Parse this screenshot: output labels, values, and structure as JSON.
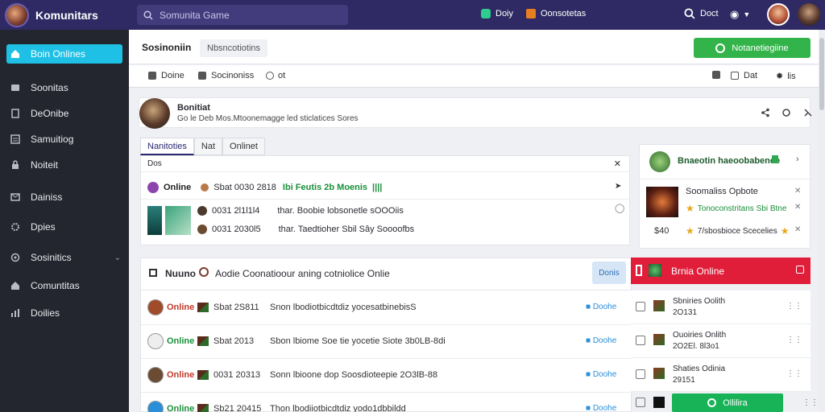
{
  "app": {
    "name": "Komunitars"
  },
  "search": {
    "placeholder": "Somunita Game"
  },
  "top": {
    "link1": "Doiy",
    "link2": "Oonsotetas",
    "link3": "Doct"
  },
  "sidebar": {
    "items": [
      {
        "label": "Boin Onlines",
        "icon": "home-icon"
      },
      {
        "label": "Soonitas",
        "icon": "tools-icon"
      },
      {
        "label": "DeOnibe",
        "icon": "document-icon"
      },
      {
        "label": "Samuitiog",
        "icon": "list-icon"
      },
      {
        "label": "Noiteit",
        "icon": "lock-icon"
      },
      {
        "label": "Dainiss",
        "icon": "mail-icon"
      },
      {
        "label": "Dpies",
        "icon": "gear-icon"
      },
      {
        "label": "Sosinitics",
        "icon": "shield-icon"
      },
      {
        "label": "Comuntitas",
        "icon": "house-icon"
      },
      {
        "label": "Doilies",
        "icon": "chart-icon"
      }
    ]
  },
  "header": {
    "title": "Sosinoniin",
    "chip": "Nbsncotiotins",
    "button": "Notanetiegiine"
  },
  "toolbar": {
    "left1": "Doine",
    "left2": "Socinoniss",
    "left3": "ot",
    "right1": "Dat",
    "right2": "lis"
  },
  "profile": {
    "name": "Bonitiat",
    "sub": "Go le Deb Mos.Mtoonemagge led sticlatices Sores"
  },
  "tabs": [
    "Nanitoties",
    "Nat",
    "Onlinet"
  ],
  "panel": {
    "head": "Dos",
    "row1": {
      "status": "Online",
      "time": "Sbat 0030 2818",
      "extra": "Ibi  Feutis 2b  Moenis",
      "tag": "||||"
    },
    "row2": {
      "time": "0031 2l1l1l4",
      "msg": "thar. Boobie lobsonetle sOOOiis"
    },
    "row3": {
      "time": "0031 2030l5",
      "msg": "thar. Taedtioher Sbil Sây Soooofbs"
    }
  },
  "rightcard": {
    "head": "Bnaeotin haeoobabence",
    "title": "Soomaliss Opbote",
    "line1": "Tonoconstritans Sbi Btne",
    "price": "$40",
    "line2": "7/sbosbioce Scecelies"
  },
  "feed": {
    "header": "Nuuno",
    "header_msg": "Aodie Coonatioour aning cotniolice Onlie",
    "button": "Donis",
    "rows": [
      {
        "status": "Online",
        "time": "Sbat 2S811",
        "msg": "Snon lbodiotbicdtdiz yocesatbinebisS",
        "link": "Doohe",
        "color": "#c0392b"
      },
      {
        "status": "Online",
        "time": "Sbat 2013",
        "msg": "Sbon lbiome Soe tie yocetie Siote 3b0LB-8di",
        "link": "Doohe",
        "color": "#1a8f3a"
      },
      {
        "status": "Online",
        "time": "0031 20313",
        "msg": "Sonn lbioone dop Soosdioteepie 2O3lB-88",
        "link": "Doohe",
        "color": "#c0392b"
      },
      {
        "status": "Online",
        "time": "Sb21 20415",
        "msg": "Thon lbodiiotbicdtdiz yodo1dbbildd",
        "link": "Doohe",
        "color": "#1a8f3a"
      }
    ]
  },
  "alert": {
    "label": "Brnia Online"
  },
  "side_rows": [
    {
      "t1": "Sbniries Oolith",
      "t2": "2O131"
    },
    {
      "t1": "Ouoiries Onlith",
      "t2": "2O2El. 8l3o1"
    },
    {
      "t1": "Shaties Odinia",
      "t2": "29151"
    }
  ],
  "online_button": "Ollilira",
  "colors": {
    "topbar": "#2f2a63",
    "accent": "#1ec0e6",
    "green": "#33b44a",
    "red": "#e01e3a"
  }
}
